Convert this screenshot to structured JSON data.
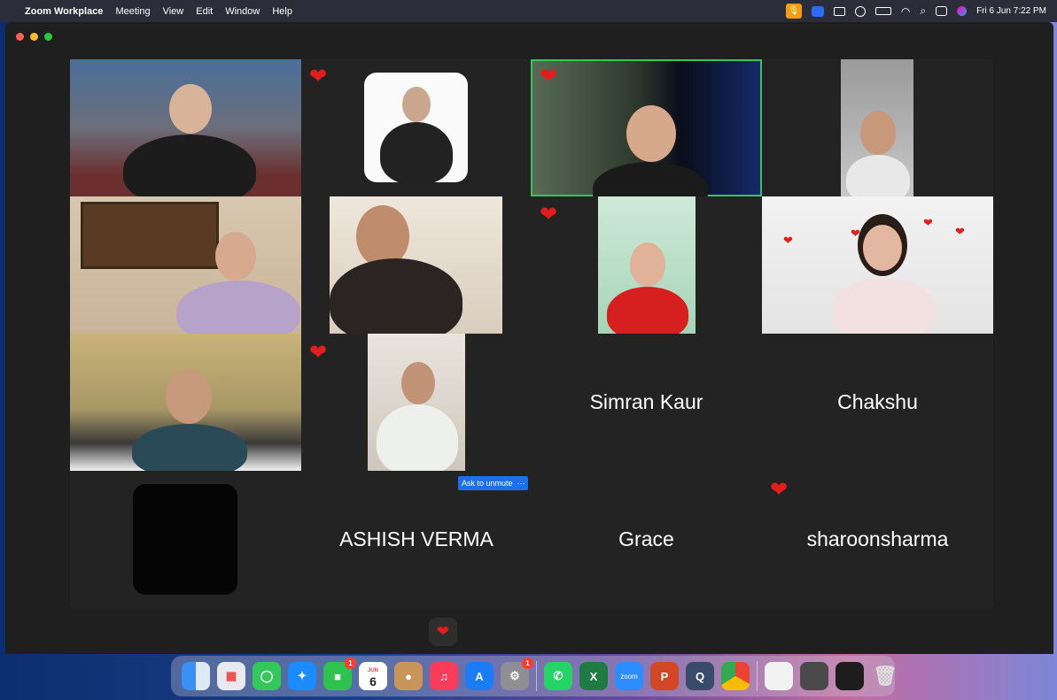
{
  "menubar": {
    "app_name": "Zoom Workplace",
    "menus": [
      "Meeting",
      "View",
      "Edit",
      "Window",
      "Help"
    ],
    "datetime": "Fri 6 Jun  7:22 PM"
  },
  "participants": {
    "name_tiles": {
      "simran": "Simran Kaur",
      "chakshu": "Chakshu",
      "ashish": "ASHISH VERMA",
      "grace": "Grace",
      "sharoon": "sharoonsharma"
    }
  },
  "controls": {
    "ask_to_unmute": "Ask to unmute",
    "more": "···",
    "reaction_glyph": "❤"
  },
  "dock": {
    "calendar_month": "JUN",
    "calendar_day": "6",
    "facetime_badge": "1",
    "settings_badge": "1",
    "zoom_label": "zoom"
  }
}
